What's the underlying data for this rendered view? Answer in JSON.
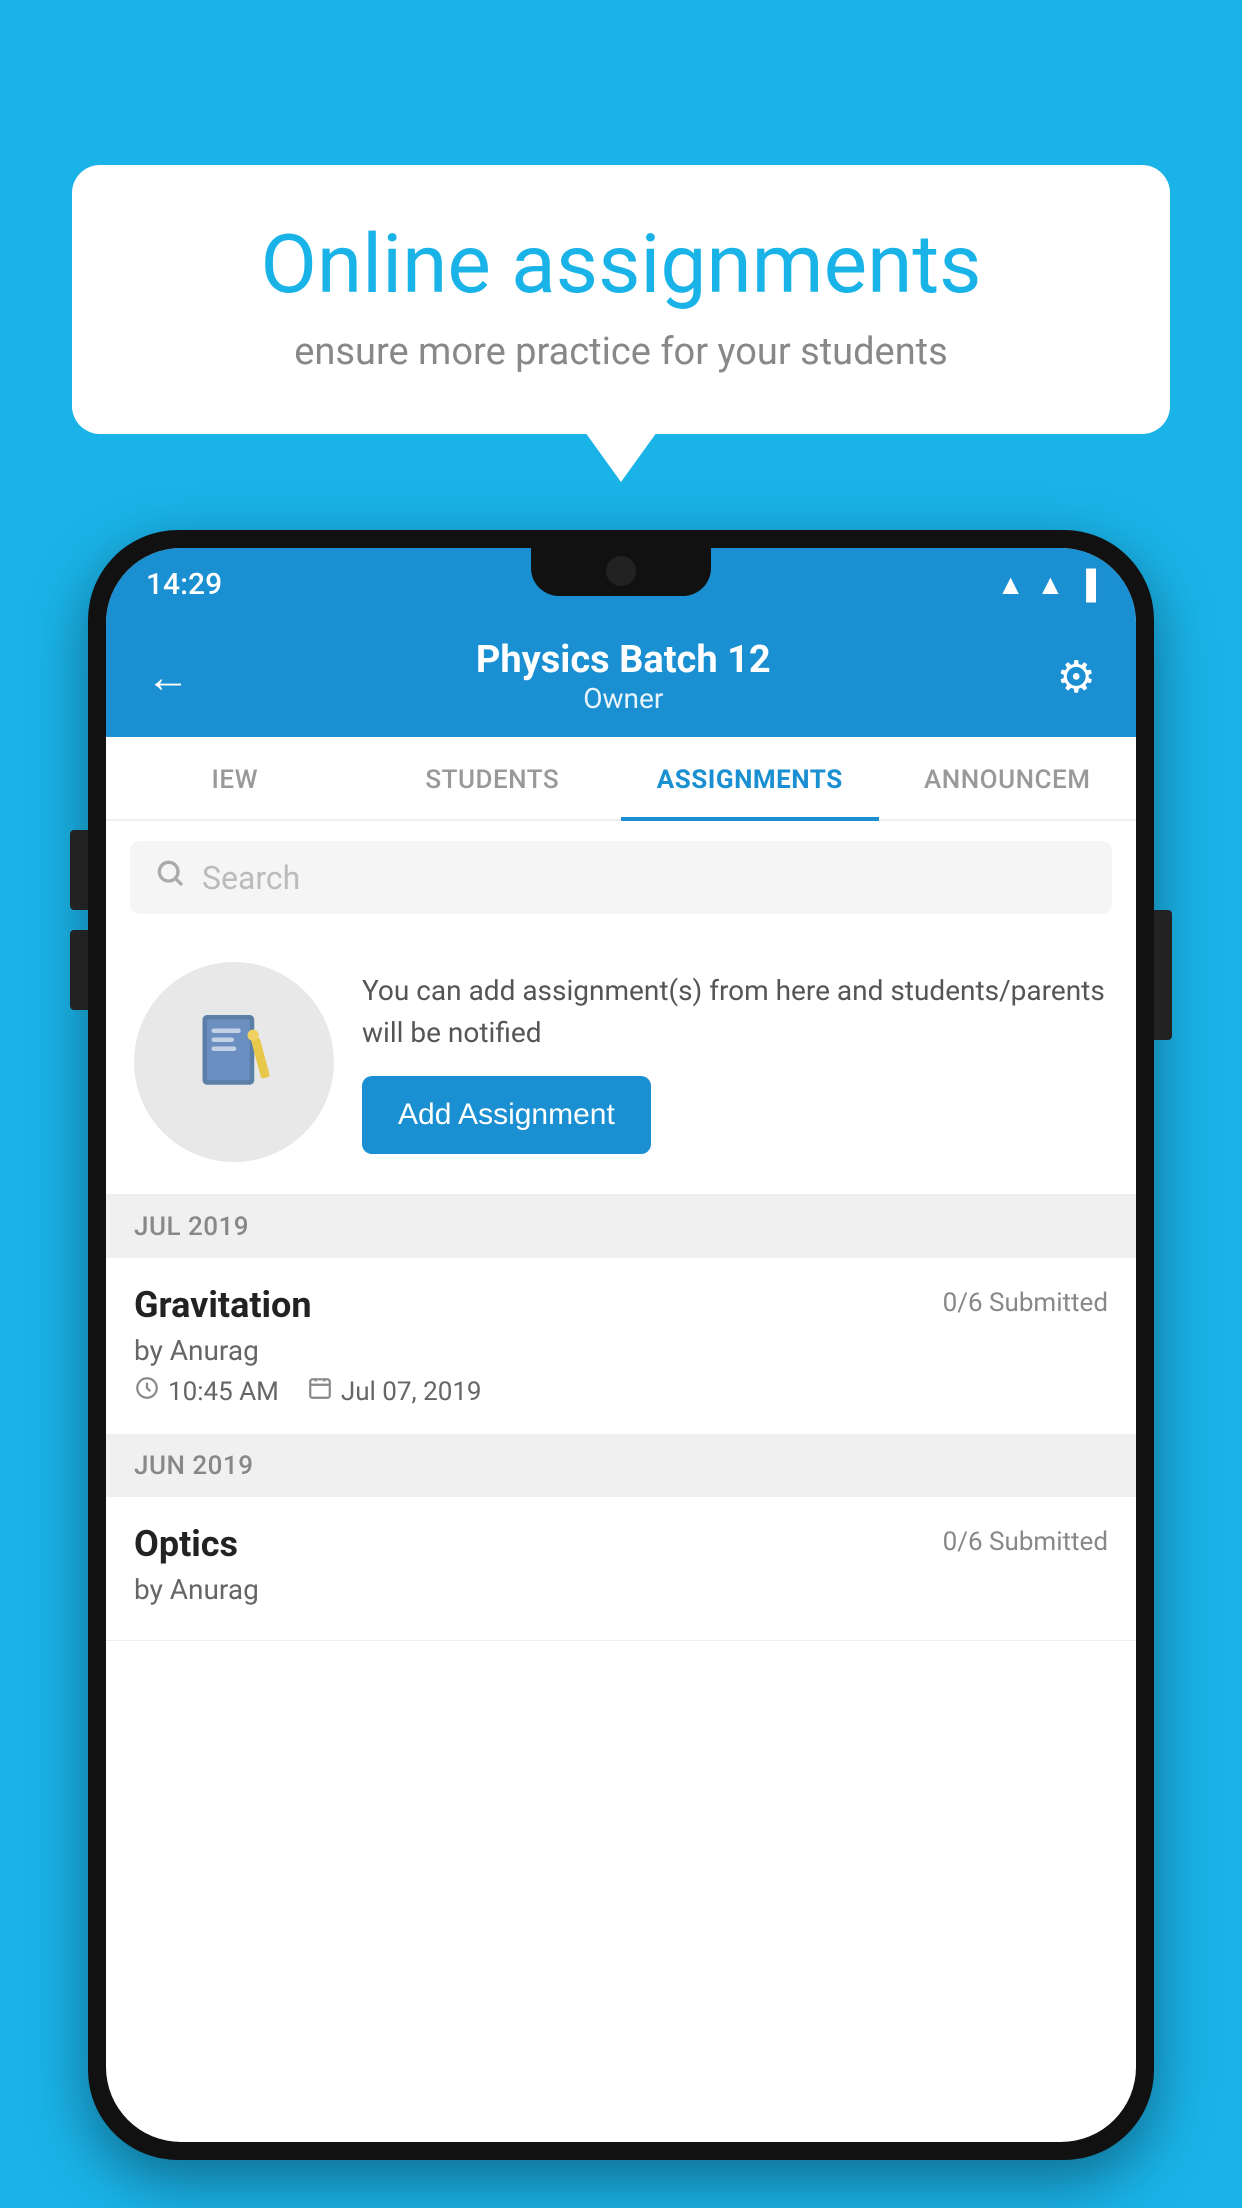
{
  "background": {
    "color": "#1ab3e8"
  },
  "speech_bubble": {
    "title": "Online assignments",
    "subtitle": "ensure more practice for your students"
  },
  "status_bar": {
    "time": "14:29",
    "wifi": "▲",
    "signal": "▲",
    "battery": "▐"
  },
  "header": {
    "title": "Physics Batch 12",
    "subtitle": "Owner",
    "back_label": "←",
    "gear_label": "⚙"
  },
  "tabs": [
    {
      "label": "IEW",
      "active": false
    },
    {
      "label": "STUDENTS",
      "active": false
    },
    {
      "label": "ASSIGNMENTS",
      "active": true
    },
    {
      "label": "ANNOUNCEM",
      "active": false
    }
  ],
  "search": {
    "placeholder": "Search"
  },
  "info_banner": {
    "icon": "📓",
    "text": "You can add assignment(s) from here and students/parents will be notified",
    "button_label": "Add Assignment"
  },
  "sections": [
    {
      "label": "JUL 2019",
      "assignments": [
        {
          "name": "Gravitation",
          "submitted": "0/6 Submitted",
          "author": "by Anurag",
          "time": "10:45 AM",
          "date": "Jul 07, 2019"
        }
      ]
    },
    {
      "label": "JUN 2019",
      "assignments": [
        {
          "name": "Optics",
          "submitted": "0/6 Submitted",
          "author": "by Anurag",
          "time": "",
          "date": ""
        }
      ]
    }
  ]
}
